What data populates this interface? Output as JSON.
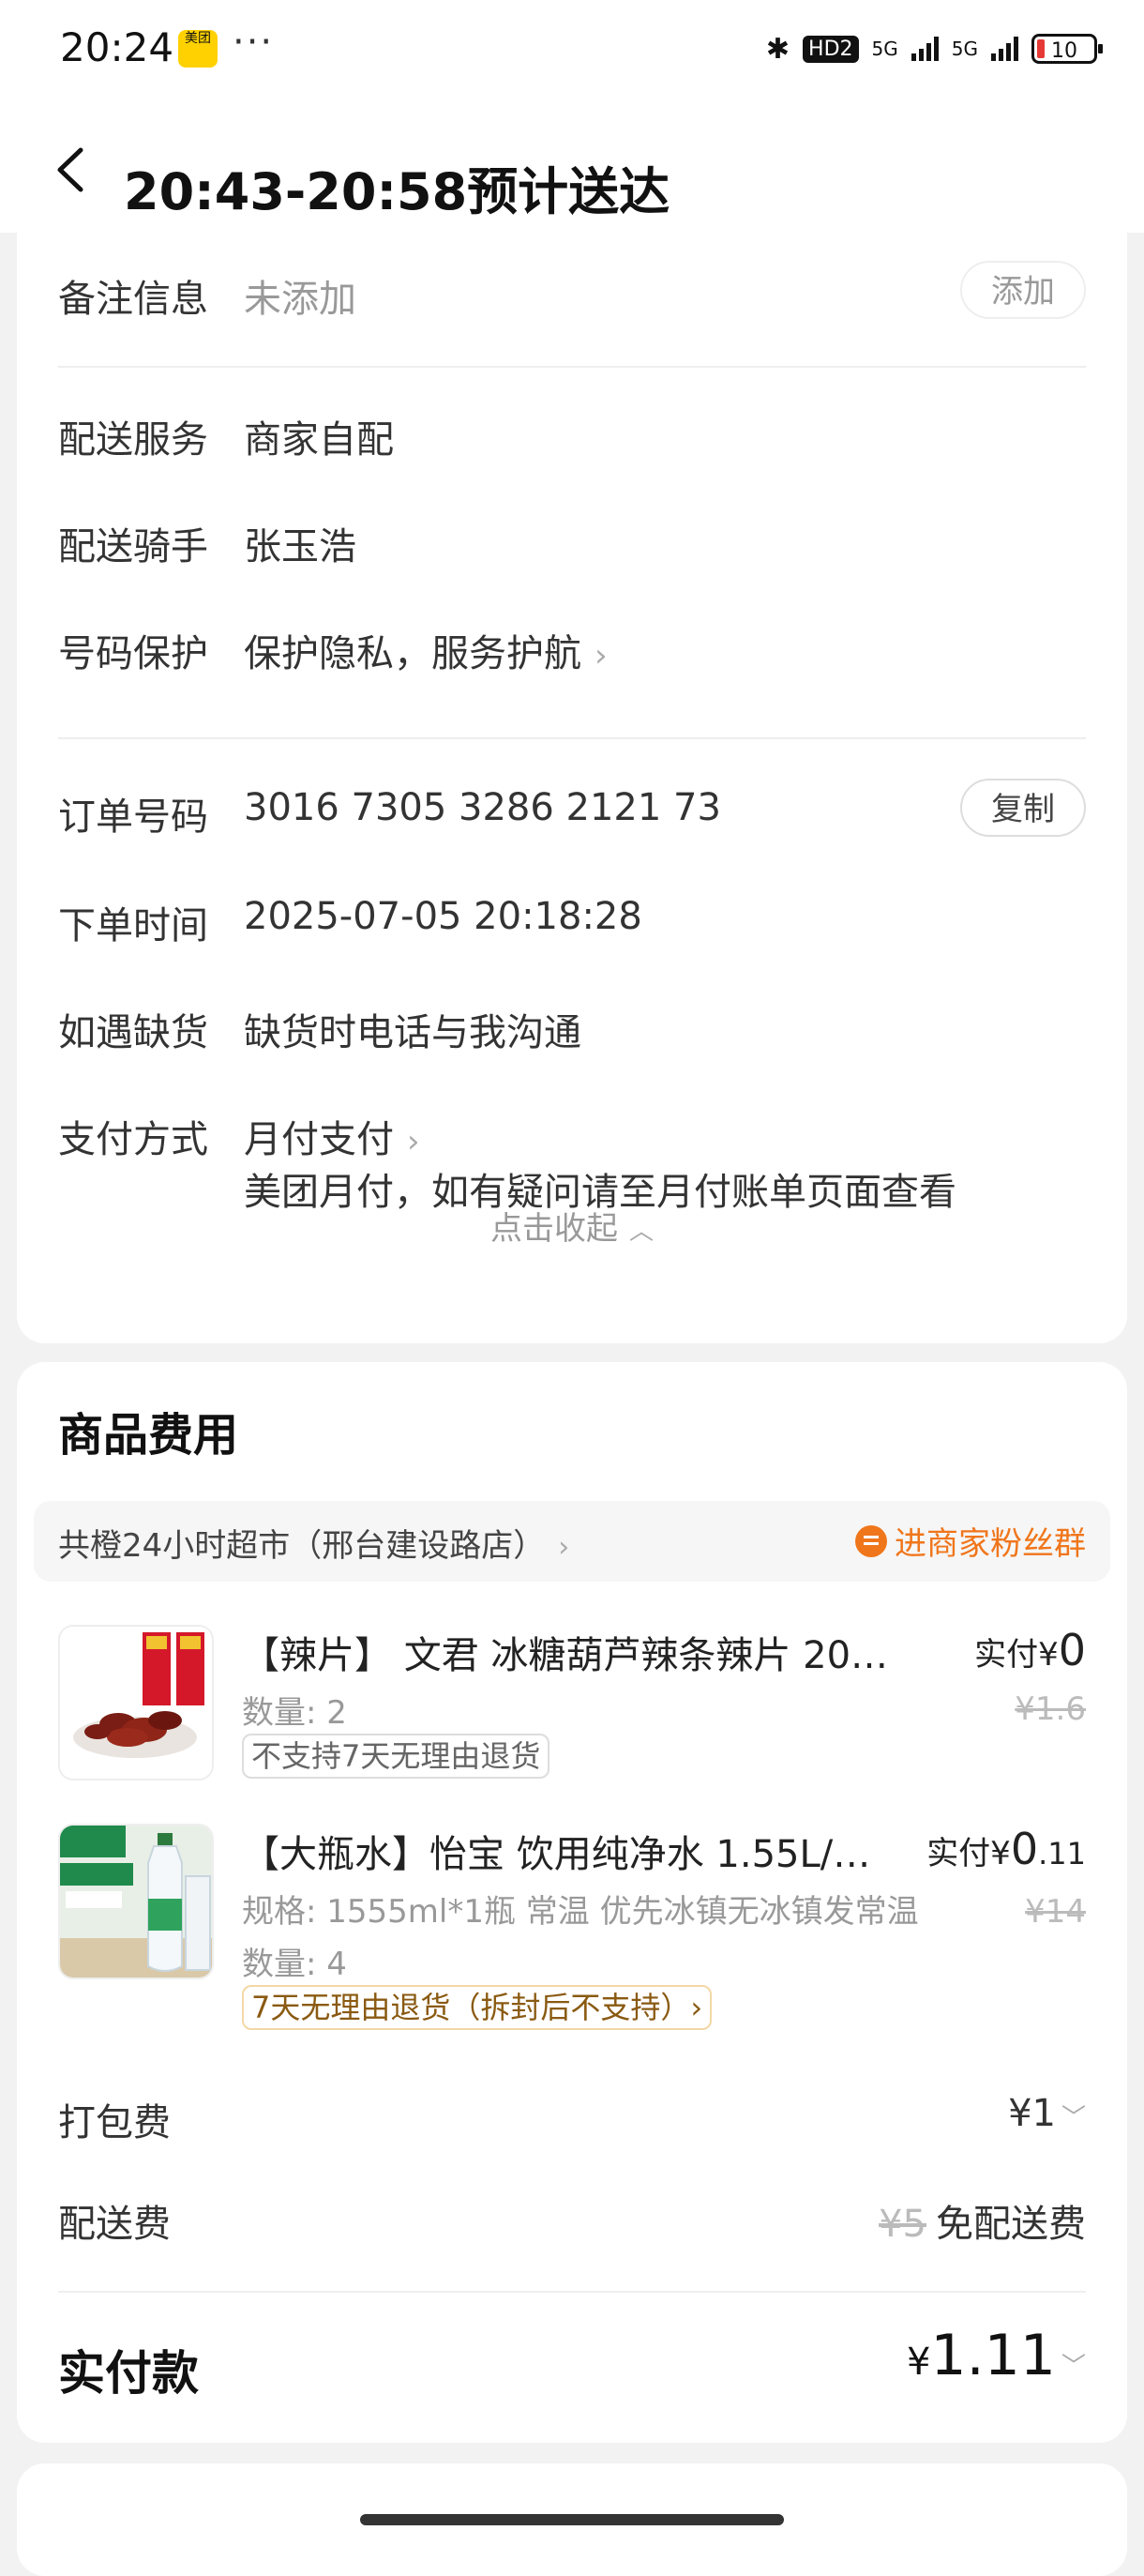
{
  "status_bar": {
    "time": "20:24",
    "app_badge": "美团",
    "dots": "···",
    "hd_label": "HD2",
    "net1": "5G",
    "net2": "5G",
    "battery": "10"
  },
  "header": {
    "title": "20:43-20:58预计送达"
  },
  "details": {
    "remark": {
      "label": "备注信息",
      "value": "未添加",
      "button": "添加"
    },
    "delivery_service": {
      "label": "配送服务",
      "value": "商家自配"
    },
    "rider": {
      "label": "配送骑手",
      "value": "张玉浩"
    },
    "number_protect": {
      "label": "号码保护",
      "value": "保护隐私，服务护航"
    },
    "order_no": {
      "label": "订单号码",
      "value": "3016 7305 3286 2121 73",
      "button": "复制"
    },
    "order_time": {
      "label": "下单时间",
      "value": "2025-07-05 20:18:28"
    },
    "out_of_stock": {
      "label": "如遇缺货",
      "value": "缺货时电话与我沟通"
    },
    "payment": {
      "label": "支付方式",
      "value": "月付支付",
      "note": "美团月付，如有疑问请至月付账单页面查看"
    },
    "collapse": "点击收起"
  },
  "goods": {
    "title": "商品费用",
    "store": "共橙24小时超市（邢台建设路店）",
    "fans_group": "进商家粉丝群",
    "items": [
      {
        "name": "【辣片】 文君 冰糖葫芦辣条辣片 20g…",
        "qty": "数量: 2",
        "tag": "不支持7天无理由退货",
        "pay_prefix": "实付¥",
        "pay_int": "0",
        "pay_dec": "",
        "orig": "¥1.6"
      },
      {
        "name": "【大瓶水】怡宝 饮用纯净水 1.55L/…",
        "spec": "规格: 1555ml*1瓶 常温 优先冰镇无冰镇发常温",
        "qty": "数量: 4",
        "tag": "7天无理由退货（拆封后不支持）›",
        "pay_prefix": "实付¥",
        "pay_int": "0",
        "pay_dec": ".11",
        "orig": "¥14"
      }
    ],
    "packing_fee": {
      "label": "打包费",
      "value": "¥1"
    },
    "delivery_fee": {
      "label": "配送费",
      "orig": "¥5",
      "value": "免配送费"
    },
    "total": {
      "label": "实付款",
      "currency": "¥",
      "amount": "1.11"
    }
  },
  "colors": {
    "accent_orange": "#f0761b",
    "tag_gold": "#8a5a12",
    "muted": "#999999"
  }
}
